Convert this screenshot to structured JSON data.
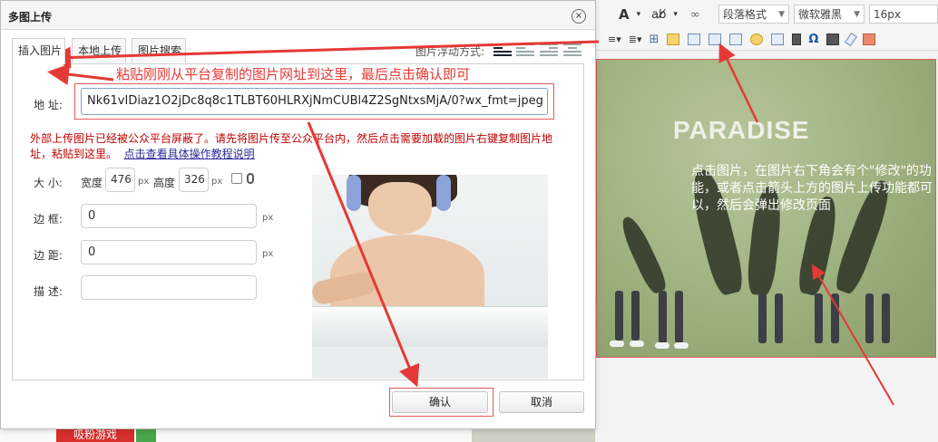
{
  "editor": {
    "toolbar": {
      "row1_glyphs": [
        "A",
        "▾",
        "ab̸",
        "▾",
        "∞"
      ],
      "paragraph_format": "段落格式",
      "font_family": "微软雅黑",
      "font_size": "16px",
      "row2_glyphs": [
        "≡▾",
        "≣▾",
        "⊞"
      ],
      "omega": "Ω"
    },
    "image_text": "PARADISE",
    "note_right": "点击图片，在图片右下角会有个\"修改\"的功能，或者点击箭头上方的图片上传功能都可以，然后会弹出修改页面"
  },
  "background": {
    "xifen_label": "吸粉游戏"
  },
  "dialog": {
    "title": "多图上传",
    "close_glyph": "×",
    "tabs": [
      {
        "label": "插入图片",
        "active": true
      },
      {
        "label": "本地上传",
        "active": false
      },
      {
        "label": "图片搜索",
        "active": false
      }
    ],
    "float_label": "图片浮动方式:",
    "callout_top": "粘贴刚刚从平台复制的图片网址到这里，最后点击确认即可",
    "address_label": "地 址:",
    "address_value": "Nk61vIDiaz1O2jDc8q8c1TLBT60HLRXjNmCUBl4Z2SgNtxsMjA/0?wx_fmt=jpeg",
    "warning_text": "外部上传图片已经被公众平台屏蔽了。请先将图片传至公众平台内，然后点击需要加载的图片右键复制图片地址，粘贴到这里。",
    "warning_link": "点击查看具体操作教程说明",
    "size_label": "大 小:",
    "width_label": "宽度",
    "width_value": "476",
    "height_label": "高度",
    "height_value": "326",
    "unit": "px",
    "border_label": "边 框:",
    "border_value": "0",
    "margin_label": "边 距:",
    "margin_value": "0",
    "desc_label": "描 述:",
    "desc_value": "",
    "ok_label": "确认",
    "cancel_label": "取消"
  },
  "colors": {
    "annotation_red": "#e53935",
    "warning_red": "#c00000",
    "link_blue": "#2a2a9a"
  }
}
